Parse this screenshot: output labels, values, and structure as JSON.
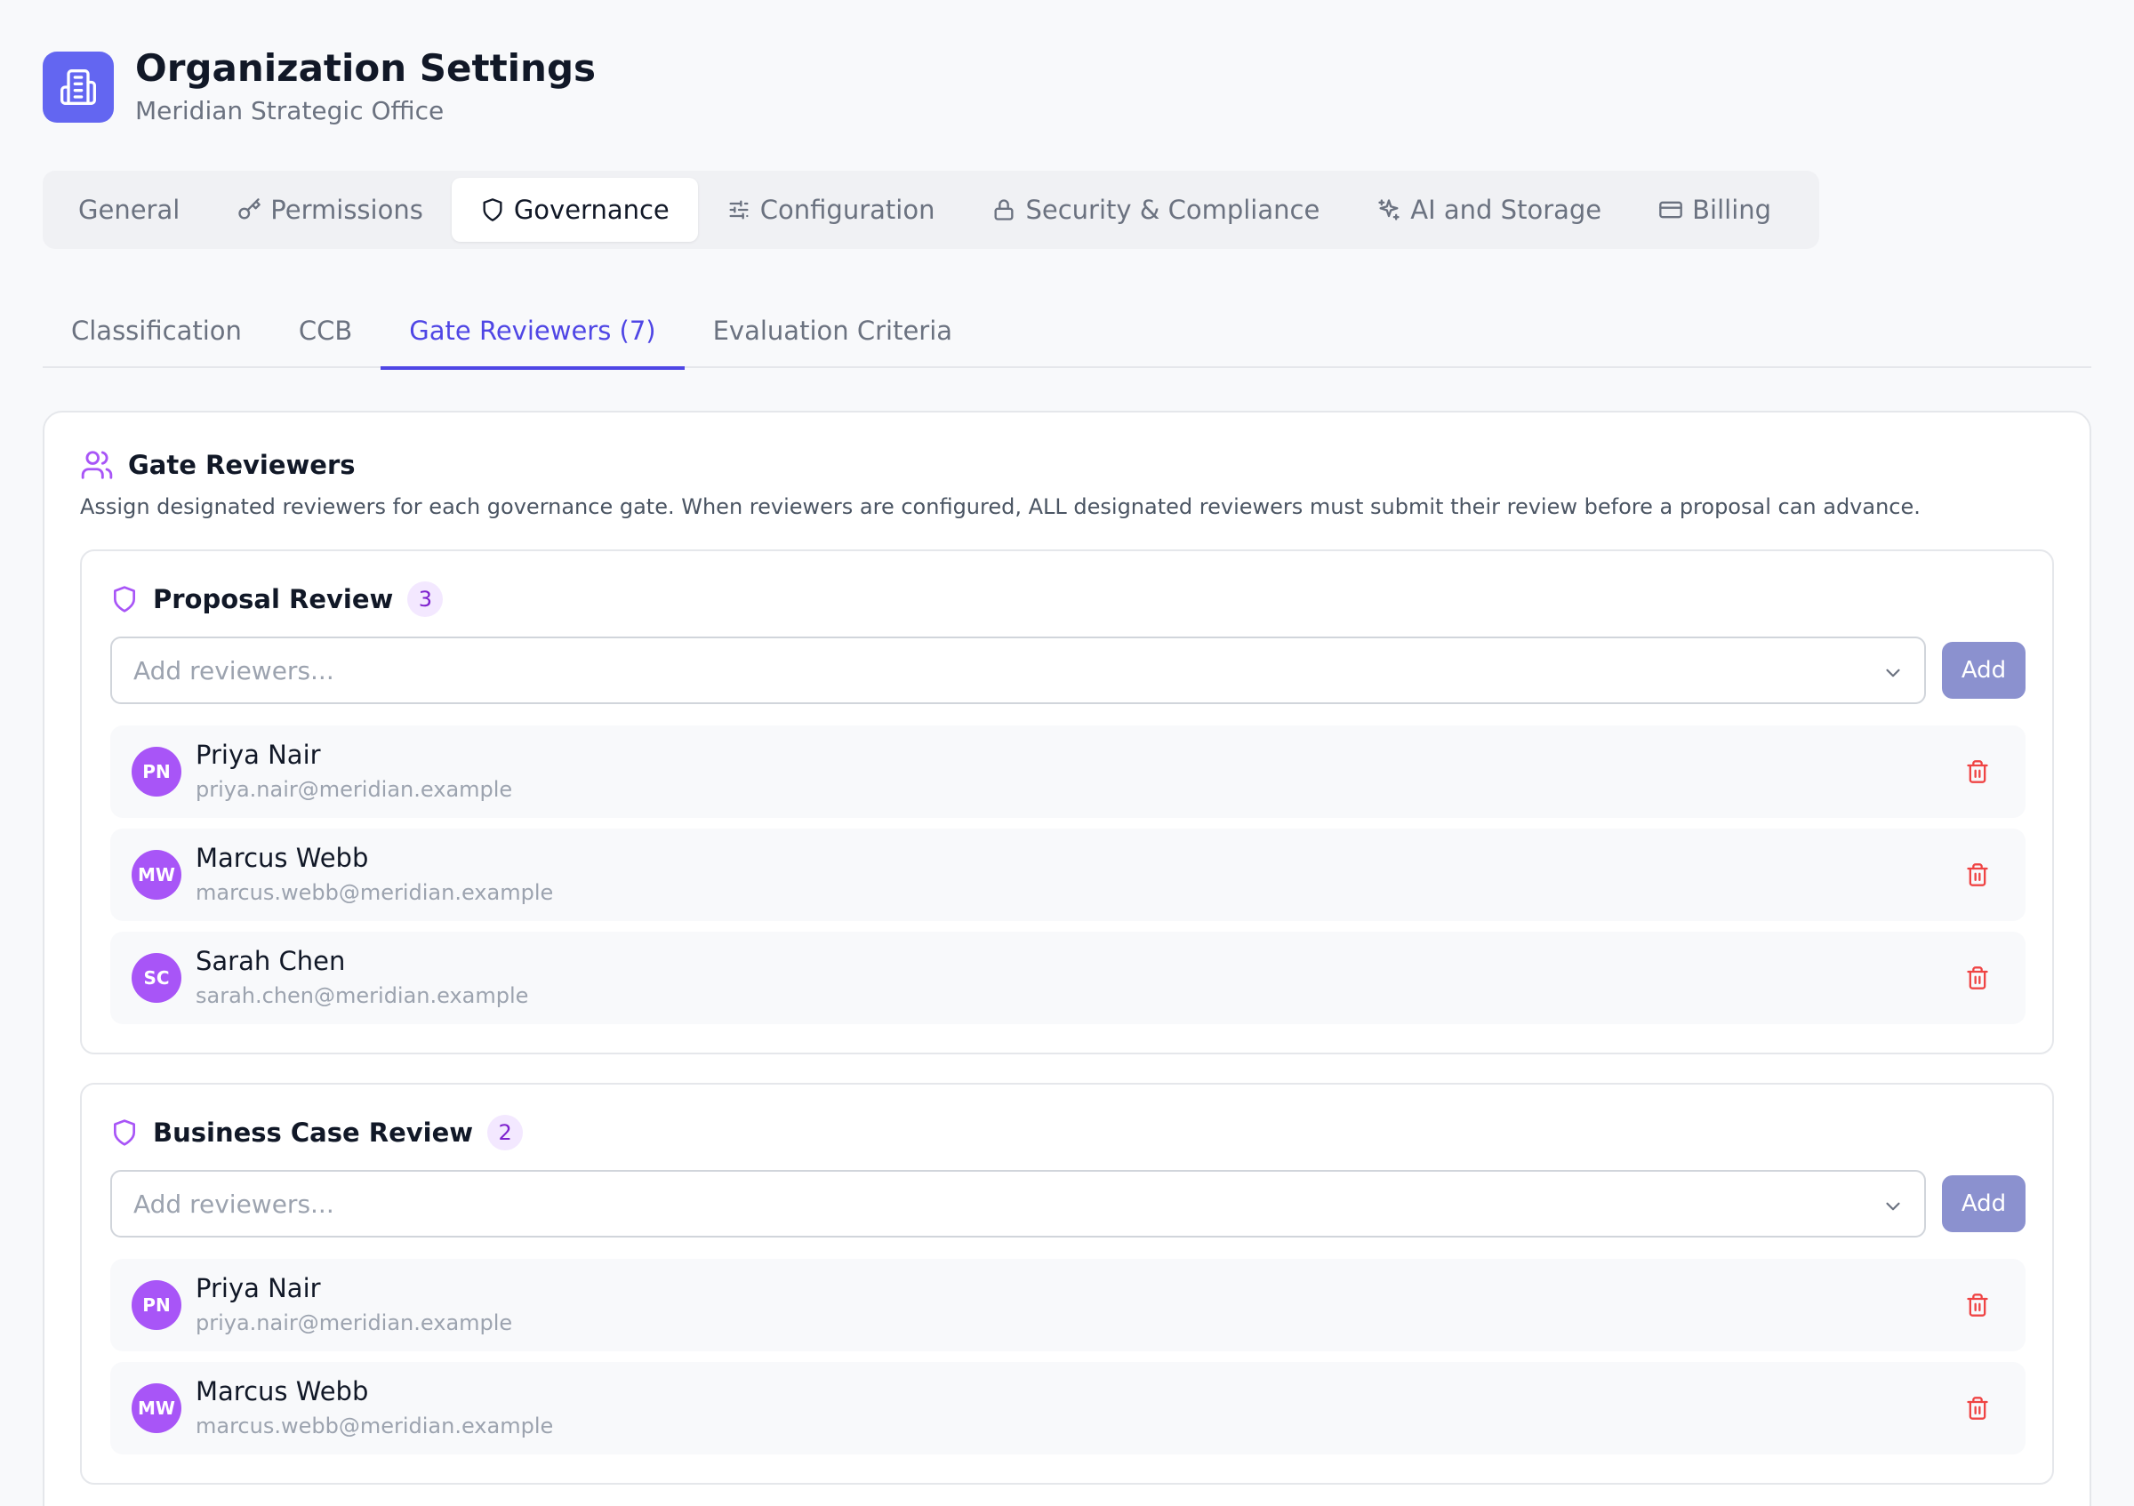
{
  "header": {
    "title": "Organization Settings",
    "subtitle": "Meridian Strategic Office",
    "logo_icon": "building-icon",
    "accent_color": "#6366f1"
  },
  "main_tabs": [
    {
      "label": "General",
      "icon": "",
      "active": false
    },
    {
      "label": "Permissions",
      "icon": "key-icon",
      "active": false
    },
    {
      "label": "Governance",
      "icon": "shield-icon",
      "active": true
    },
    {
      "label": "Configuration",
      "icon": "sliders-icon",
      "active": false
    },
    {
      "label": "Security & Compliance",
      "icon": "lock-icon",
      "active": false
    },
    {
      "label": "AI and Storage",
      "icon": "sparkles-icon",
      "active": false
    },
    {
      "label": "Billing",
      "icon": "credit-card-icon",
      "active": false
    }
  ],
  "sub_tabs": [
    {
      "label": "Classification",
      "active": false
    },
    {
      "label": "CCB",
      "active": false
    },
    {
      "label": "Gate Reviewers (7)",
      "active": true
    },
    {
      "label": "Evaluation Criteria",
      "active": false
    }
  ],
  "card": {
    "title": "Gate Reviewers",
    "icon": "users-icon",
    "description": "Assign designated reviewers for each governance gate. When reviewers are configured, ALL designated reviewers must submit their review before a proposal can advance."
  },
  "gates": [
    {
      "title": "Proposal Review",
      "count": "3",
      "placeholder": "Add reviewers...",
      "add_label": "Add",
      "reviewers": [
        {
          "initials": "PN",
          "name": "Priya Nair",
          "email": "priya.nair@meridian.example"
        },
        {
          "initials": "MW",
          "name": "Marcus Webb",
          "email": "marcus.webb@meridian.example"
        },
        {
          "initials": "SC",
          "name": "Sarah Chen",
          "email": "sarah.chen@meridian.example"
        }
      ]
    },
    {
      "title": "Business Case Review",
      "count": "2",
      "placeholder": "Add reviewers...",
      "add_label": "Add",
      "reviewers": [
        {
          "initials": "PN",
          "name": "Priya Nair",
          "email": "priya.nair@meridian.example"
        },
        {
          "initials": "MW",
          "name": "Marcus Webb",
          "email": "marcus.webb@meridian.example"
        }
      ]
    }
  ],
  "colors": {
    "active_tab_underline": "#4f46e5",
    "avatar": "#a855f7",
    "delete": "#ef4444",
    "add_button": "#8b91cf"
  }
}
